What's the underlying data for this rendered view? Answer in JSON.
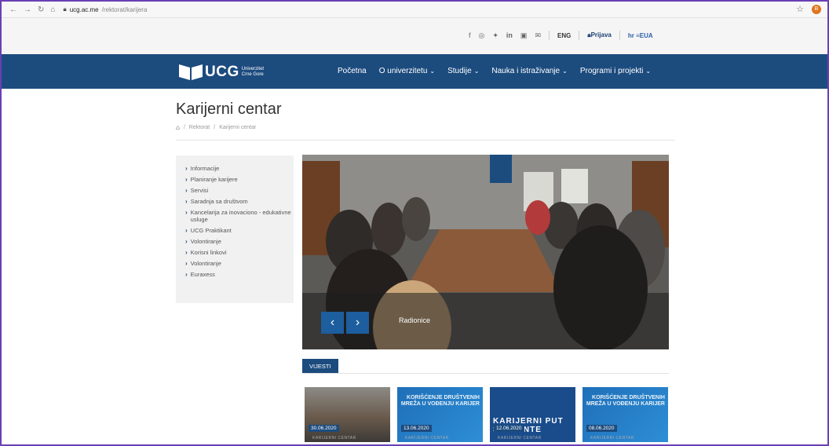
{
  "browser": {
    "host": "ucg.ac.me",
    "path": "/rektorat/karijera",
    "avatar_letter": "B"
  },
  "util": {
    "icons": [
      "facebook-icon",
      "instagram-icon",
      "twitter-icon",
      "linkedin-icon",
      "youtube-icon",
      "mail-icon"
    ],
    "eng": "ENG",
    "prijava": "Prijava",
    "eua": "EUA"
  },
  "logo": {
    "word": "UCG",
    "line1": "Univerzitet",
    "line2": "Crne Gore"
  },
  "menu": [
    {
      "label": "Početna",
      "dropdown": false
    },
    {
      "label": "O univerzitetu",
      "dropdown": true
    },
    {
      "label": "Studije",
      "dropdown": true
    },
    {
      "label": "Nauka i istraživanje",
      "dropdown": true
    },
    {
      "label": "Programi i projekti",
      "dropdown": true
    }
  ],
  "page": {
    "title": "Karijerni centar",
    "breadcrumb": [
      "Rektorat",
      "Karijerni centar"
    ]
  },
  "sidebar": [
    "Informacije",
    "Planiranje karijere",
    "Servisi",
    "Saradnja sa društvom",
    "Kancelarija za inovaciono - edukativne usluge",
    "UCG Praktikant",
    "Volontiranje",
    "Korisni linkovi",
    "Volontiranje",
    "Euraxess"
  ],
  "slider": {
    "caption": "Radionice",
    "prev": "‹",
    "next": "›",
    "banner": "UCG"
  },
  "news": {
    "tab": "VIJESTI",
    "cards": [
      {
        "date": "30.06.2020",
        "style": "photo"
      },
      {
        "date": "13.06.2020",
        "style": "blue",
        "text": "KORIŠĆENJE DRUŠTVENIH MREŽA U VOĐENJU KARIJER"
      },
      {
        "date": "12.06.2020",
        "style": "karijerni",
        "text": "KARIJERNI PUT STUDENTE"
      },
      {
        "date": "08.06.2020",
        "style": "blue",
        "text": "KORIŠĆENJE DRUŠTVENIH MREŽA U VOĐENJU KARIJER"
      }
    ],
    "meta": "KARIJERNI CENTAR"
  },
  "colors": {
    "brand": "#1c4b7e",
    "control": "#1c5e9e"
  }
}
